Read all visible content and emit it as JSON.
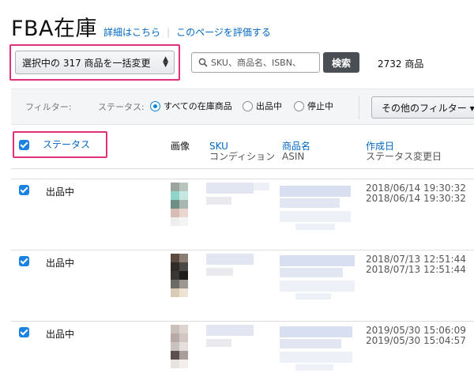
{
  "header": {
    "title": "FBA在庫",
    "details_link": "詳細はこちら",
    "separator": "|",
    "rate_link": "このページを評価する"
  },
  "toolbar": {
    "bulk_label": "選択中の 317 商品を一括変更",
    "bulk_arrows": "⬍",
    "search_placeholder": "SKU、商品名、ISBN、",
    "search_button": "検索",
    "product_count": "2732 商品"
  },
  "filters": {
    "filter_label": "フィルター:",
    "status_label": "ステータス:",
    "options": [
      {
        "label": "すべての在庫商品",
        "selected": true
      },
      {
        "label": "出品中",
        "selected": false
      },
      {
        "label": "停止中",
        "selected": false
      }
    ],
    "more_label": "その他のフィルター ▾"
  },
  "table": {
    "columns": {
      "status": "ステータス",
      "image": "画像",
      "sku": "SKU",
      "condition": "コンディション",
      "name": "商品名",
      "asin": "ASIN",
      "created": "作成日",
      "status_changed": "ステータス変更日"
    },
    "rows": [
      {
        "status": "出品中",
        "created": "2018/06/14 19:30:32",
        "changed": "2018/06/14 19:30:32",
        "checked": true
      },
      {
        "status": "出品中",
        "created": "2018/07/13 12:51:44",
        "changed": "2018/07/13 12:51:44",
        "checked": true
      },
      {
        "status": "出品中",
        "created": "2019/05/30 15:06:09",
        "changed": "2019/05/30 15:04:57",
        "checked": true
      }
    ]
  },
  "colors": {
    "accent": "#0066c0",
    "highlight": "#e0317a",
    "checkbox": "#1a82e2",
    "search_button": "#4a4f55"
  }
}
